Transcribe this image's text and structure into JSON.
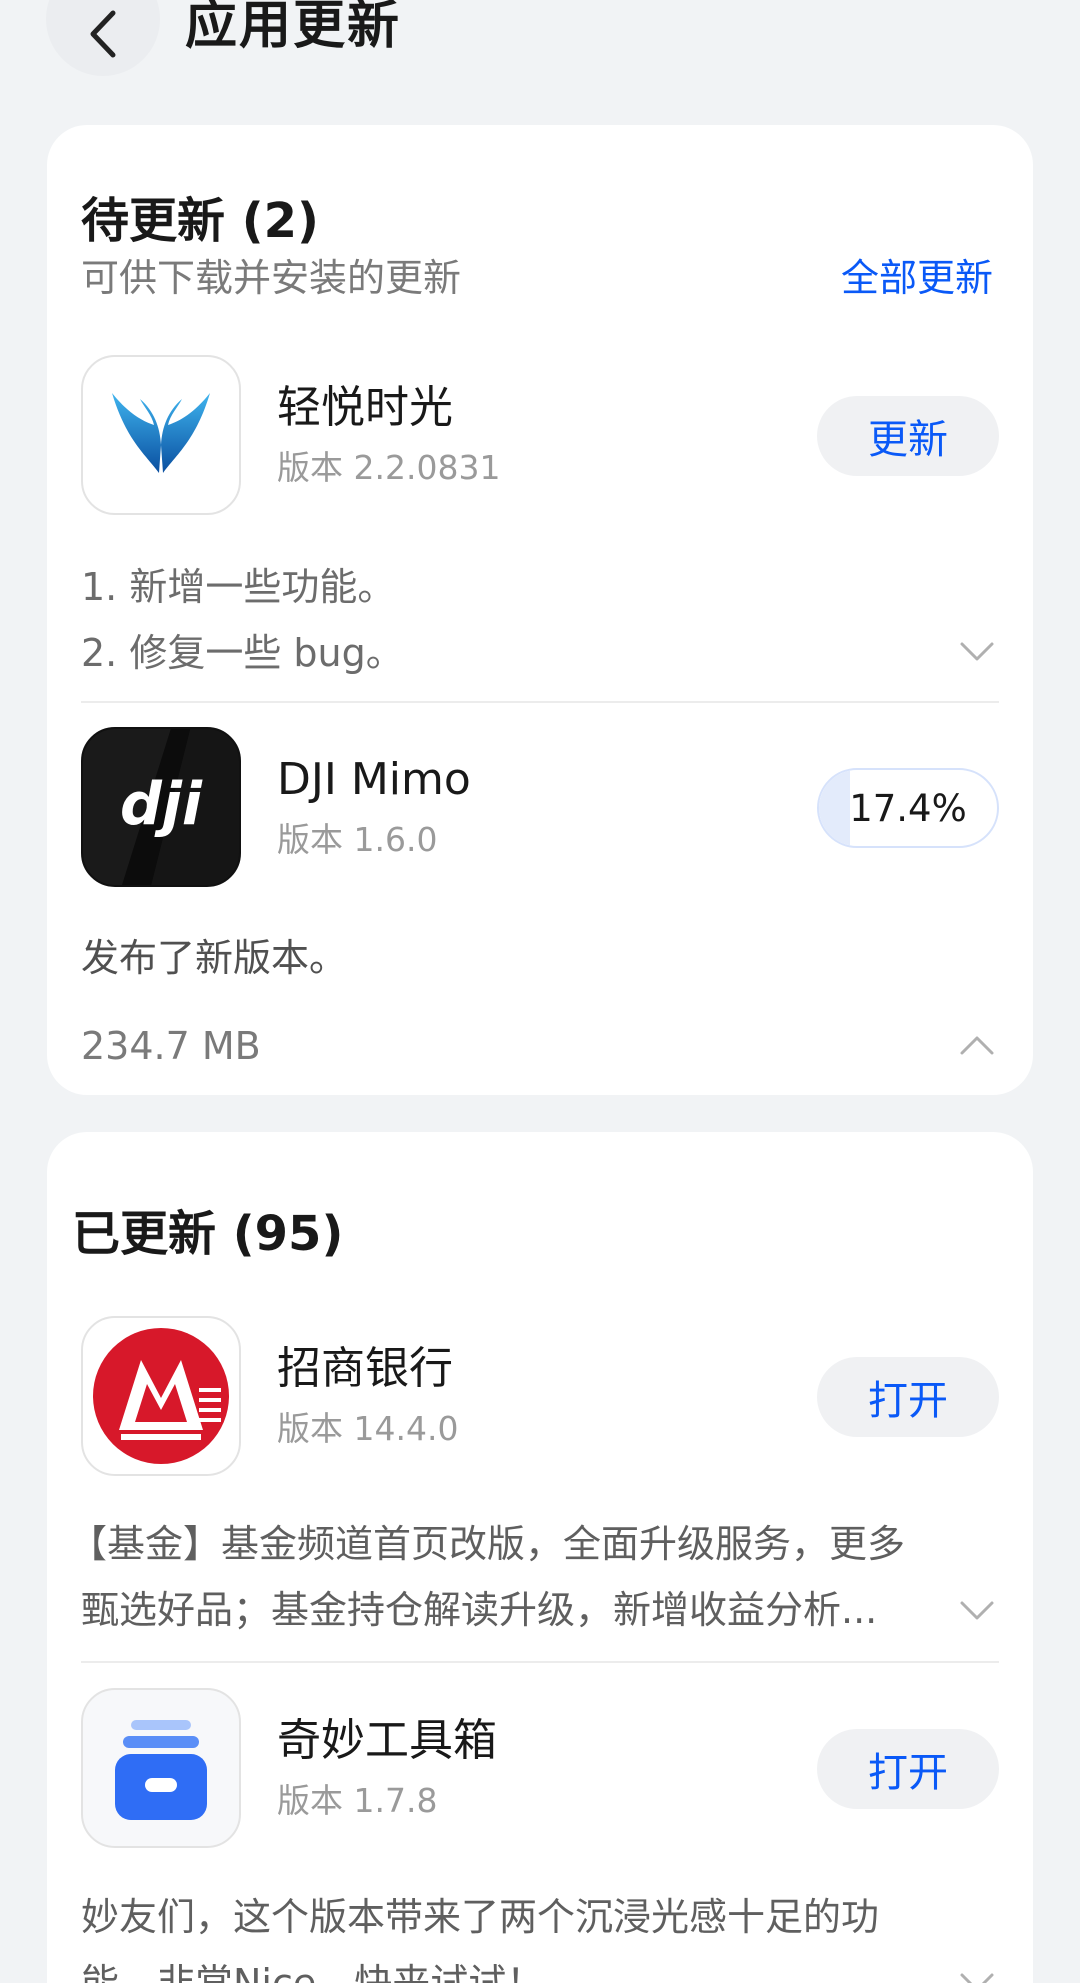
{
  "header": {
    "title": "应用更新",
    "back_icon": "chevron-left-icon"
  },
  "pending": {
    "title": "待更新 (2)",
    "subtitle": "可供下载并安装的更新",
    "update_all_label": "全部更新",
    "apps": [
      {
        "name": "轻悦时光",
        "version": "版本 2.2.0831",
        "action_label": "更新",
        "notes": [
          "1. 新增一些功能。",
          "2. 修复一些 bug。"
        ],
        "icon": "blue-wings-icon"
      },
      {
        "name": "DJI Mimo",
        "version": "版本 1.6.0",
        "progress_text": "17.4%",
        "progress_fraction": 0.174,
        "notes": [
          "发布了新版本。"
        ],
        "size": "234.7 MB",
        "icon": "dji-logo-icon"
      }
    ]
  },
  "updated": {
    "title": "已更新 (95)",
    "apps": [
      {
        "name": "招商银行",
        "version": "版本 14.4.0",
        "action_label": "打开",
        "notes": [
          "【基金】基金频道首页改版，全面升级服务，更多",
          "甄选好品；基金持仓解读升级，新增收益分析..."
        ],
        "icon": "cmb-logo-icon"
      },
      {
        "name": "奇妙工具箱",
        "version": "版本 1.7.8",
        "action_label": "打开",
        "notes": [
          "妙友们，这个版本带来了两个沉浸光感十足的功",
          "能，非常Nice，快来试试！"
        ],
        "icon": "toolbox-icon"
      }
    ]
  },
  "colors": {
    "accent": "#0a59f7",
    "background": "#f1f3f5",
    "card": "#ffffff",
    "cmb_red": "#d7182a"
  }
}
